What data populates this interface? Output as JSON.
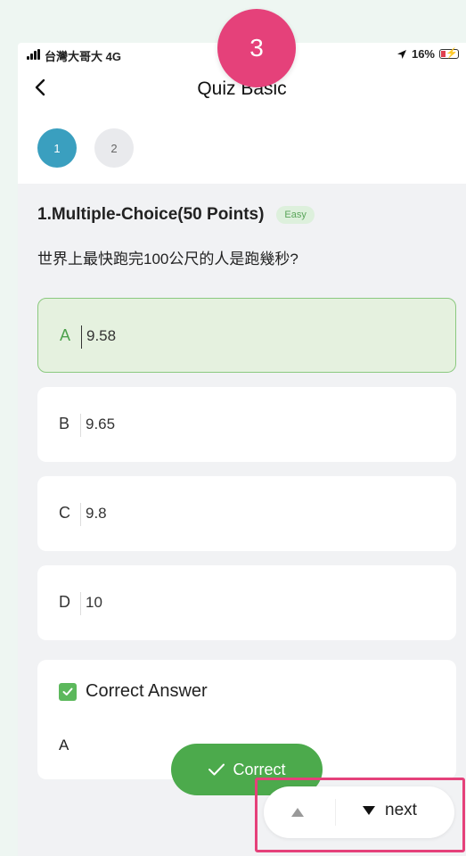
{
  "status_bar": {
    "carrier": "台灣大哥大  4G",
    "battery": "16%"
  },
  "header": {
    "title": "Quiz Basic"
  },
  "steps": [
    "1",
    "2"
  ],
  "question": {
    "title": "1.Multiple-Choice(50 Points)",
    "difficulty": "Easy",
    "text": "世界上最快跑完100公尺的人是跑幾秒?"
  },
  "options": [
    {
      "letter": "A",
      "value": "9.58"
    },
    {
      "letter": "B",
      "value": "9.65"
    },
    {
      "letter": "C",
      "value": "9.8"
    },
    {
      "letter": "D",
      "value": "10"
    }
  ],
  "answer": {
    "title": "Correct Answer",
    "value": "A"
  },
  "feedback": {
    "label": "Correct"
  },
  "navigation": {
    "next_label": "next"
  },
  "annotation": {
    "step_number": "3",
    "color": "#e5417a"
  },
  "colors": {
    "accent_blue": "#3a9fbf",
    "correct_green": "#4caa4c",
    "selected_bg": "#e5f1df"
  }
}
